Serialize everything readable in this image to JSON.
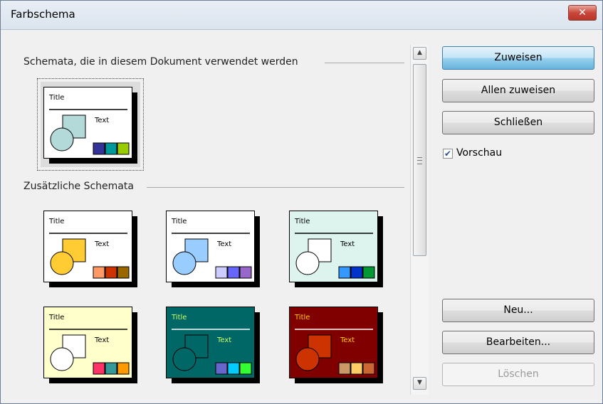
{
  "window": {
    "title": "Farbschema",
    "close_glyph": "✕"
  },
  "sections": {
    "used": "Schemata, die in diesem Dokument verwendet werden",
    "additional": "Zusätzliche Schemata"
  },
  "thumb_text": {
    "title": "Title",
    "text": "Text"
  },
  "schemes": {
    "current": {
      "bg": "#ffffff",
      "text": "#000000",
      "rule": "#000000",
      "circle": "#b3d9d9",
      "square": "#b3d9d9",
      "sw": [
        "#333399",
        "#009999",
        "#99cc00"
      ]
    },
    "additional": [
      {
        "bg": "#ffffff",
        "text": "#000000",
        "rule": "#000000",
        "circle": "#ffcc33",
        "square": "#ffcc33",
        "sw": [
          "#ff9966",
          "#cc3300",
          "#996600"
        ]
      },
      {
        "bg": "#ffffff",
        "text": "#000000",
        "rule": "#000000",
        "circle": "#99ccff",
        "square": "#99ccff",
        "sw": [
          "#ccccff",
          "#6666ff",
          "#9966cc"
        ]
      },
      {
        "bg": "#ddf3ee",
        "text": "#000000",
        "rule": "#000000",
        "circle": "#ffffff",
        "square": "#ffffff",
        "sw": [
          "#3399ff",
          "#0033cc",
          "#009933"
        ]
      },
      {
        "bg": "#ffffcc",
        "text": "#000000",
        "rule": "#000000",
        "circle": "#ffffff",
        "square": "#ffffff",
        "sw": [
          "#ff3366",
          "#339999",
          "#ff9900"
        ]
      },
      {
        "bg": "#006666",
        "text": "#ccff66",
        "rule": "#ffffff",
        "circle": "#006666",
        "square": "#006666",
        "sw": [
          "#6666cc",
          "#00ccff",
          "#33ff33"
        ]
      },
      {
        "bg": "#800000",
        "text": "#ffcc00",
        "rule": "#ffffff",
        "circle": "#cc3300",
        "square": "#cc3300",
        "sw": [
          "#cc9966",
          "#ffcc66",
          "#cc6633"
        ]
      }
    ]
  },
  "buttons": {
    "assign": "Zuweisen",
    "assign_all": "Allen zuweisen",
    "close": "Schließen",
    "new": "Neu...",
    "edit": "Bearbeiten...",
    "delete": "Löschen"
  },
  "preview": {
    "label": "Vorschau",
    "checked": true
  }
}
